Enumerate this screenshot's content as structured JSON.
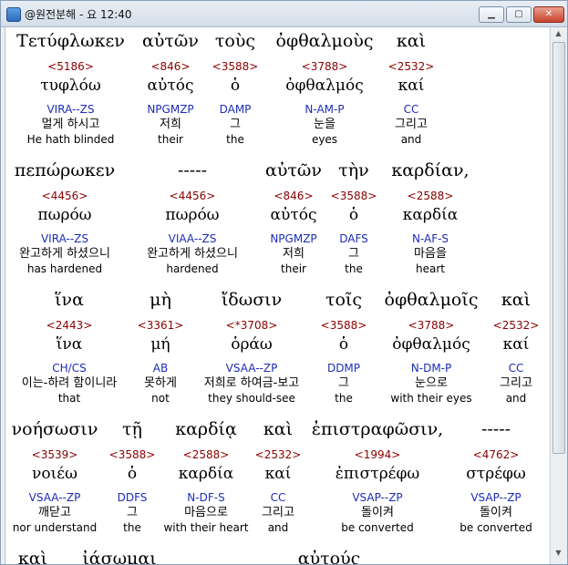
{
  "window": {
    "title": "@원전분해 - 요 12:40"
  },
  "rows": [
    {
      "words": [
        {
          "g": "Τετύφλωκεν",
          "n": "<5186>",
          "l": "τυφλόω",
          "p": "VIRA--ZS",
          "k": "멀게 하시고",
          "e": "He hath blinded"
        },
        {
          "g": "αὐτῶν",
          "n": "<846>",
          "l": "αὐτός",
          "p": "NPGMZP",
          "k": "저희",
          "e": "their"
        },
        {
          "g": "τοὺς",
          "n": "<3588>",
          "l": "ὁ",
          "p": "DAMP",
          "k": "그",
          "e": "the"
        },
        {
          "g": "ὀφθαλμοὺς",
          "n": "<3788>",
          "l": "ὀφθαλμός",
          "p": "N-AM-P",
          "k": "눈을",
          "e": "eyes"
        },
        {
          "g": "καὶ",
          "n": "<2532>",
          "l": "καί",
          "p": "CC",
          "k": "그리고",
          "e": "and"
        }
      ]
    },
    {
      "words": [
        {
          "g": "πεπώρωκεν",
          "n": "<4456>",
          "l": "πωρόω",
          "p": "VIRA--ZS",
          "k": "완고하게 하셨으니",
          "e": "has hardened"
        },
        {
          "g": "-----",
          "n": "<4456>",
          "l": "πωρόω",
          "p": "VIAA--ZS",
          "k": "완고하게 하셨으니",
          "e": "hardened"
        },
        {
          "g": "αὐτῶν",
          "n": "<846>",
          "l": "αὐτός",
          "p": "NPGMZP",
          "k": "저희",
          "e": "their"
        },
        {
          "g": "τὴν",
          "n": "<3588>",
          "l": "ὁ",
          "p": "DAFS",
          "k": "그",
          "e": "the"
        },
        {
          "g": "καρδίαν,",
          "n": "<2588>",
          "l": "καρδία",
          "p": "N-AF-S",
          "k": "마음을",
          "e": "heart"
        }
      ]
    },
    {
      "words": [
        {
          "g": "ἵνα",
          "n": "<2443>",
          "l": "ἵνα",
          "p": "CH/CS",
          "k": "이는-하려 함이니라",
          "e": "that"
        },
        {
          "g": "μὴ",
          "n": "<3361>",
          "l": "μή",
          "p": "AB",
          "k": "못하게",
          "e": "not"
        },
        {
          "g": "ἴδωσιν",
          "n": "<*3708>",
          "l": "ὁράω",
          "p": "VSAA--ZP",
          "k": "저희로 하여금-보고",
          "e": "they should-see"
        },
        {
          "g": "τοῖς",
          "n": "<3588>",
          "l": "ὁ",
          "p": "DDMP",
          "k": "그",
          "e": "the"
        },
        {
          "g": "ὀφθαλμοῖς",
          "n": "<3788>",
          "l": "ὀφθαλμός",
          "p": "N-DM-P",
          "k": "눈으로",
          "e": "with their eyes"
        },
        {
          "g": "καὶ",
          "n": "<2532>",
          "l": "καί",
          "p": "CC",
          "k": "그리고",
          "e": "and"
        }
      ]
    },
    {
      "words": [
        {
          "g": "νοήσωσιν",
          "n": "<3539>",
          "l": "νοιέω",
          "p": "VSAA--ZP",
          "k": "깨닫고",
          "e": "nor understand"
        },
        {
          "g": "τῇ",
          "n": "<3588>",
          "l": "ὁ",
          "p": "DDFS",
          "k": "그",
          "e": "the"
        },
        {
          "g": "καρδίᾳ",
          "n": "<2588>",
          "l": "καρδία",
          "p": "N-DF-S",
          "k": "마음으로",
          "e": "with their heart"
        },
        {
          "g": "καὶ",
          "n": "<2532>",
          "l": "καί",
          "p": "CC",
          "k": "그리고",
          "e": "and"
        },
        {
          "g": "ἐπιστραφῶσιν,",
          "n": "<1994>",
          "l": "ἐπιστρέφω",
          "p": "VSAP--ZP",
          "k": "돌이켜",
          "e": "be converted"
        },
        {
          "g": "-----",
          "n": "<4762>",
          "l": "στρέφω",
          "p": "VSAP--ZP",
          "k": "돌이켜",
          "e": "be converted"
        }
      ]
    },
    {
      "words": [
        {
          "g": "καὶ"
        },
        {
          "g": "ἰάσωμαι"
        },
        {
          "g": "αὐτούς"
        }
      ]
    }
  ]
}
